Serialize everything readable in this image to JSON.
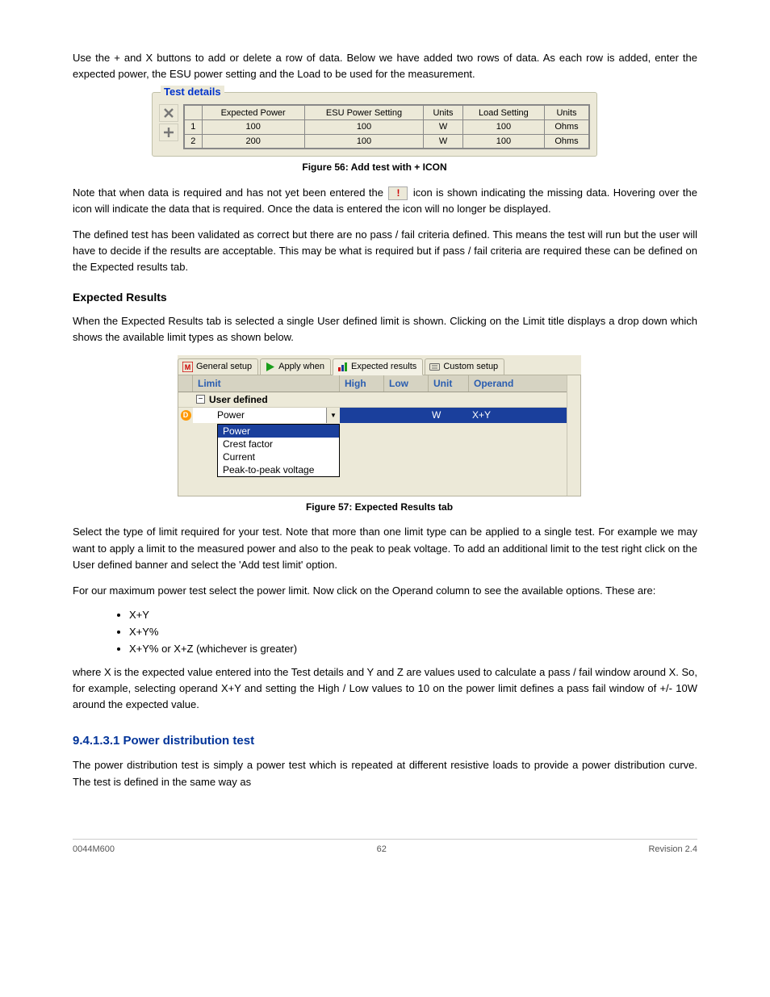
{
  "intro": {
    "p1": "Use the + and X buttons to add or delete a row of data. Below we have added two rows of data. As each row is added, enter the expected power, the ESU power setting and the Load to be used for the measurement.",
    "fig1_caption": "Figure 56: Add test with + ICON"
  },
  "test_details": {
    "legend": "Test details",
    "headers": [
      "",
      "Expected Power",
      "ESU Power Setting",
      "Units",
      "Load Setting",
      "Units"
    ],
    "rows": [
      {
        "n": "1",
        "expected": "100",
        "esu": "100",
        "u1": "W",
        "load": "100",
        "u2": "Ohms"
      },
      {
        "n": "2",
        "expected": "200",
        "esu": "100",
        "u1": "W",
        "load": "100",
        "u2": "Ohms"
      }
    ]
  },
  "mid": {
    "p2_a": "Note that when data is required and has not yet been entered the ",
    "p2_b": " icon is shown indicating the missing data. Hovering over the icon will indicate the data that is required. Once the data is entered the icon will no longer be displayed.",
    "err_tooltip": "!",
    "p3": "The defined test has been validated as correct but there are no pass / fail criteria defined. This means the test will run but the user will have to decide if the results are acceptable. This may be what is required but if pass / fail criteria are required these can be defined on the Expected results tab.",
    "h_expected": "Expected Results",
    "p4": "When the Expected Results tab is selected a single User defined limit is shown. Clicking on the Limit title displays a drop down which shows the available limit types as shown below.",
    "fig2_caption": "Figure 57: Expected Results tab"
  },
  "tabs": {
    "general": "General setup",
    "apply": "Apply when",
    "expected": "Expected results",
    "custom": "Custom setup"
  },
  "limits_panel": {
    "headers": {
      "limit": "Limit",
      "high": "High",
      "low": "Low",
      "unit": "Unit",
      "operand": "Operand"
    },
    "group": "User defined",
    "selected": {
      "limit": "Power",
      "unit": "W",
      "operand": "X+Y"
    },
    "dropdown": [
      "Power",
      "Crest factor",
      "Current",
      "Peak-to-peak voltage"
    ]
  },
  "after": {
    "p5": "Select the type of limit required for your test. Note that more than one limit type can be applied to a single test. For example we may want to apply a limit to the measured power and also to the peak to peak voltage. To add an additional limit to the test right click on the User defined banner and select the 'Add test limit' option.",
    "p6": "For our maximum power test select the power limit. Now click on the Operand column to see the available options. These are:",
    "bullets": [
      "X+Y",
      "X+Y%",
      "X+Y% or X+Z (whichever is greater)"
    ],
    "p7": "where X is the expected value entered into the Test details and Y and Z are values used to calculate a pass / fail window around X. So, for example, selecting operand X+Y and setting the High / Low values to 10 on the power limit defines a pass fail window of +/- 10W around the expected value.",
    "h_pd": "9.4.1.3.1 Power distribution test",
    "p8": "The power distribution test is simply a power test which is repeated at different resistive loads to provide a power distribution curve. The test is defined in the same way as"
  },
  "footer": {
    "left": "0044M600",
    "center": "62",
    "right": "Revision 2.4"
  }
}
